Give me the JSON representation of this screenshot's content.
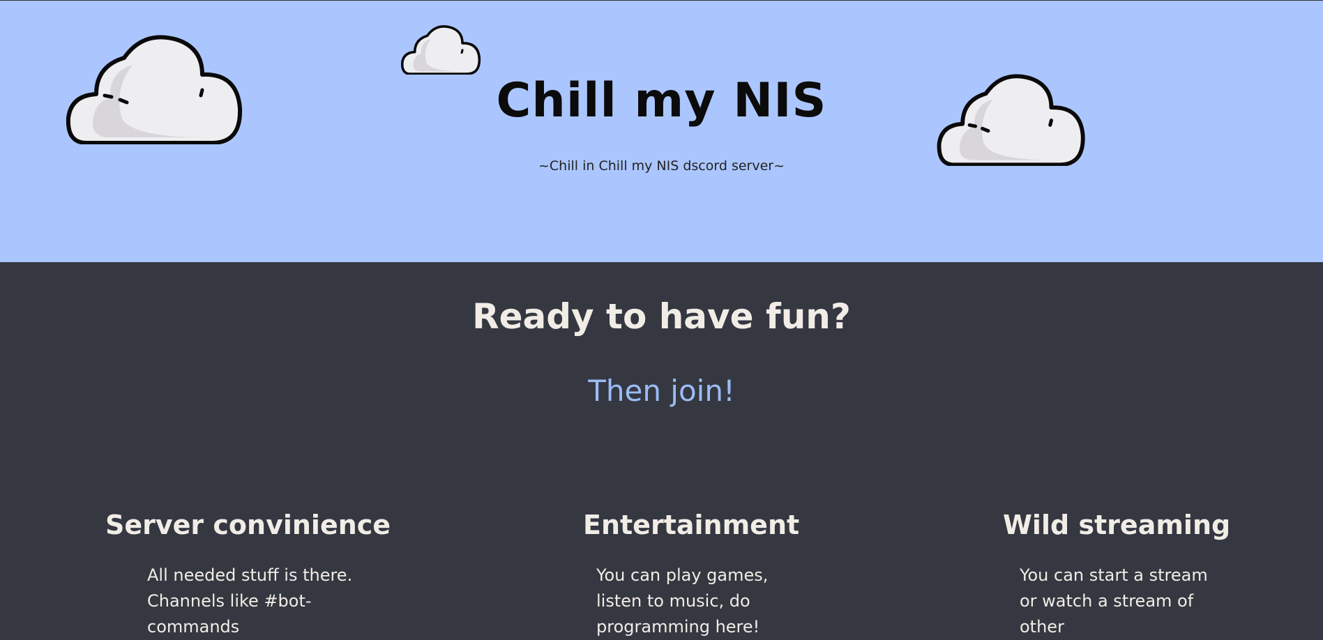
{
  "hero": {
    "title": "Chill my NIS",
    "subtitle": "~Chill in Chill my NIS dscord server~",
    "background": "#abc6ff"
  },
  "section": {
    "heading": "Ready to have fun?",
    "join_label": "Then join!",
    "background": "#353841",
    "accent": "#9bbcf5"
  },
  "features": [
    {
      "title": "Server convinience",
      "text": "All needed stuff is there. Channels like #bot-commands"
    },
    {
      "title": "Entertainment",
      "text": "You can play games, listen to music, do programming here!"
    },
    {
      "title": "Wild streaming",
      "text": "You can start a stream or watch a stream of other"
    }
  ],
  "icons": [
    "cloud-icon"
  ]
}
